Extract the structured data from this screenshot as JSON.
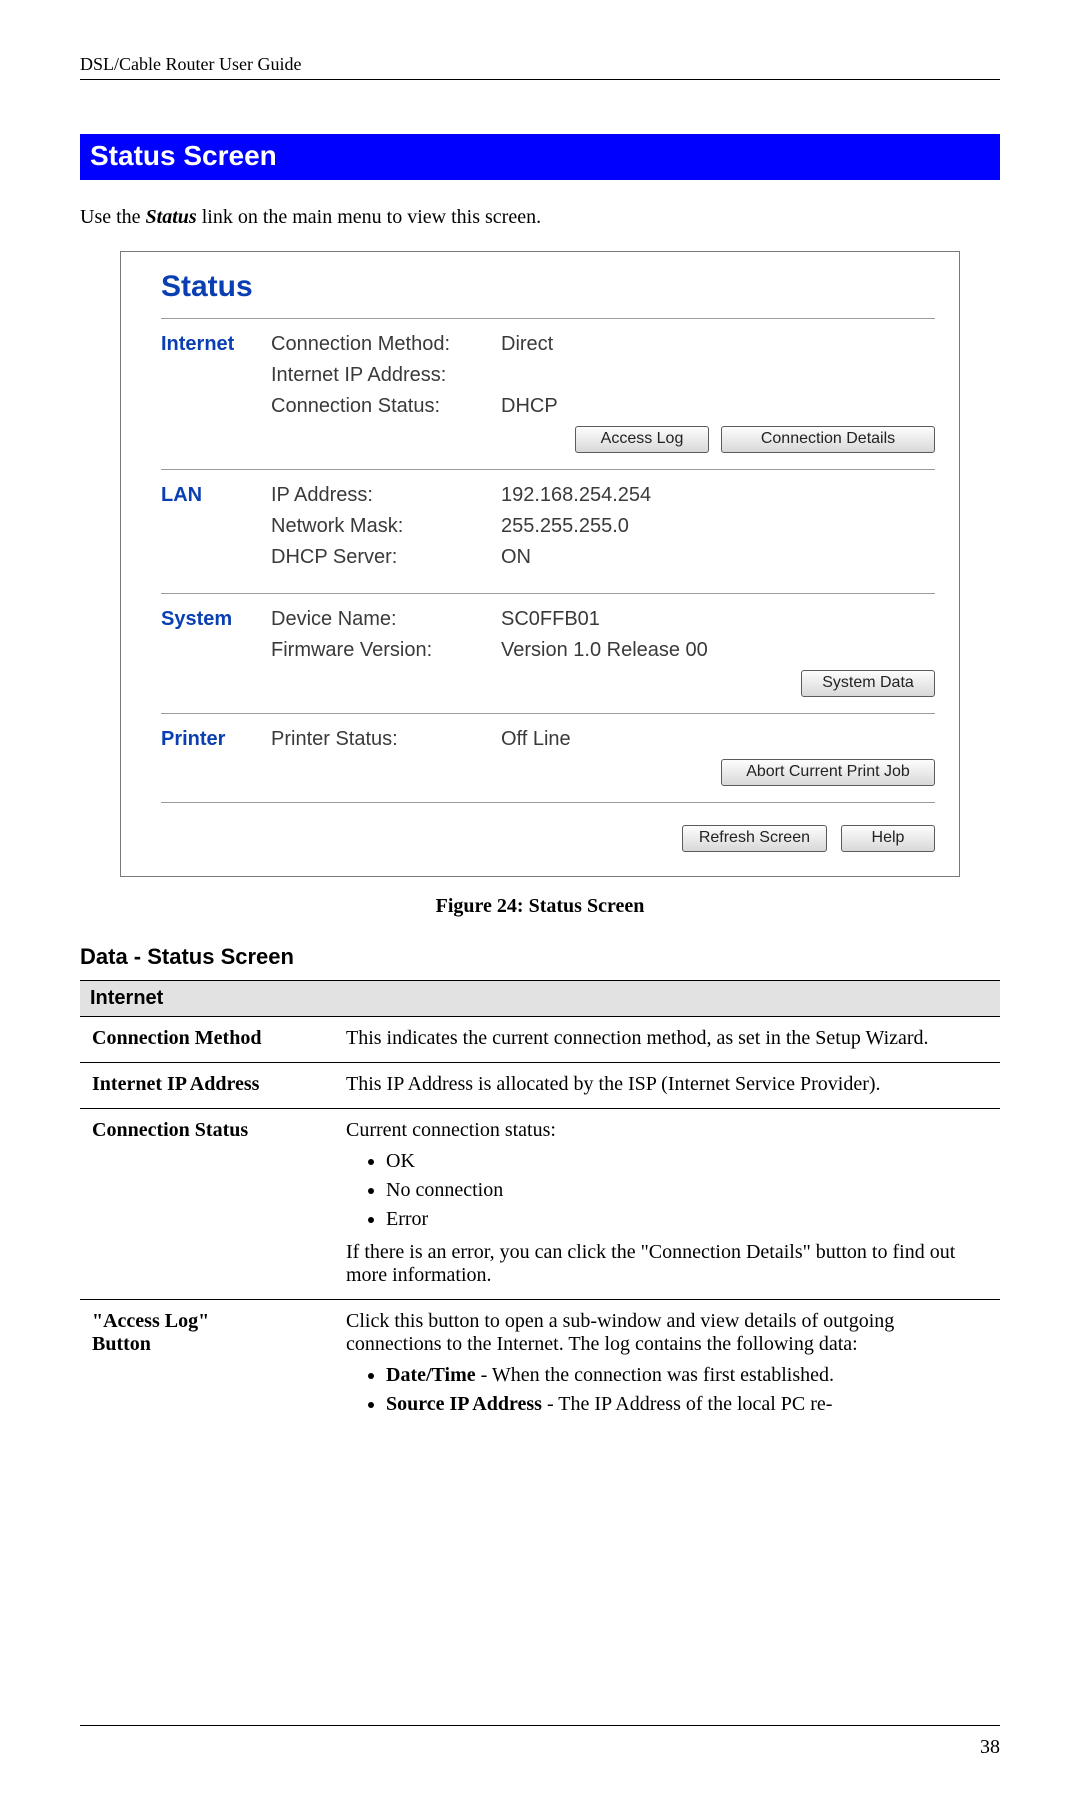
{
  "header": "DSL/Cable Router User Guide",
  "section_title": "Status Screen",
  "intro_prefix": "Use the ",
  "intro_bold_italic": "Status",
  "intro_suffix": " link on the main menu to view this screen.",
  "shot": {
    "title": "Status",
    "internet": {
      "label": "Internet",
      "rows": {
        "conn_method_k": "Connection Method:",
        "conn_method_v": "Direct",
        "ip_k": "Internet IP Address:",
        "ip_v": "",
        "status_k": "Connection Status:",
        "status_v": "DHCP"
      },
      "buttons": {
        "access_log": "Access Log",
        "conn_details": "Connection Details"
      }
    },
    "lan": {
      "label": "LAN",
      "rows": {
        "ip_k": "IP Address:",
        "ip_v": "192.168.254.254",
        "mask_k": "Network Mask:",
        "mask_v": "255.255.255.0",
        "dhcp_k": "DHCP Server:",
        "dhcp_v": "ON"
      }
    },
    "system": {
      "label": "System",
      "rows": {
        "name_k": "Device Name:",
        "name_v": "SC0FFB01",
        "fw_k": "Firmware Version:",
        "fw_v": "Version 1.0 Release 00"
      },
      "buttons": {
        "system_data": "System Data"
      }
    },
    "printer": {
      "label": "Printer",
      "rows": {
        "status_k": "Printer Status:",
        "status_v": "Off Line"
      },
      "buttons": {
        "abort": "Abort Current Print Job"
      }
    },
    "bottom_buttons": {
      "refresh": "Refresh Screen",
      "help": "Help"
    }
  },
  "figure_caption": "Figure 24: Status Screen",
  "sub_heading": "Data - Status Screen",
  "table": {
    "section_internet": "Internet",
    "rows": {
      "conn_method_term": "Connection Method",
      "conn_method_desc": "This indicates the current connection method, as set in the Setup Wizard.",
      "ip_term": "Internet IP Address",
      "ip_desc": "This IP Address is allocated by the ISP (Internet Service Provider).",
      "status_term": "Connection Status",
      "status_intro": "Current connection status:",
      "status_b1": "OK",
      "status_b2": "No connection",
      "status_b3": "Error",
      "status_outro": "If there is an error, you can click the \"Connection Details\" button to find out more information.",
      "access_term_1": "\"Access Log\"",
      "access_term_2": "Button",
      "access_intro": "Click this button to open a sub-window and view details of outgoing connections to the Internet. The log contains the following data:",
      "access_b1_bold": "Date/Time",
      "access_b1_rest": " - When the connection was first established.",
      "access_b2_bold": "Source IP Address",
      "access_b2_rest": " - The IP Address of the local PC re-"
    }
  },
  "page_number": "38"
}
